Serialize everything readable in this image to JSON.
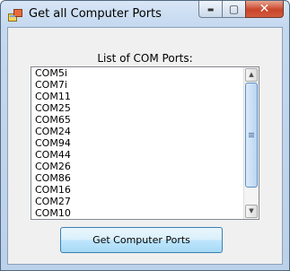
{
  "window": {
    "title": "Get all Computer Ports"
  },
  "controls": {
    "minimize_glyph": "▬",
    "maximize_glyph": "▢",
    "close_glyph": "✕"
  },
  "list": {
    "label": "List of COM Ports:",
    "items": [
      "COM5i",
      "COM7i",
      "COM11",
      "COM25",
      "COM65",
      "COM24",
      "COM94",
      "COM44",
      "COM26",
      "COM86",
      "COM16",
      "COM27",
      "COM10"
    ]
  },
  "scroll": {
    "up_glyph": "▲",
    "down_glyph": "▼"
  },
  "actions": {
    "get_ports_label": "Get Computer Ports"
  }
}
